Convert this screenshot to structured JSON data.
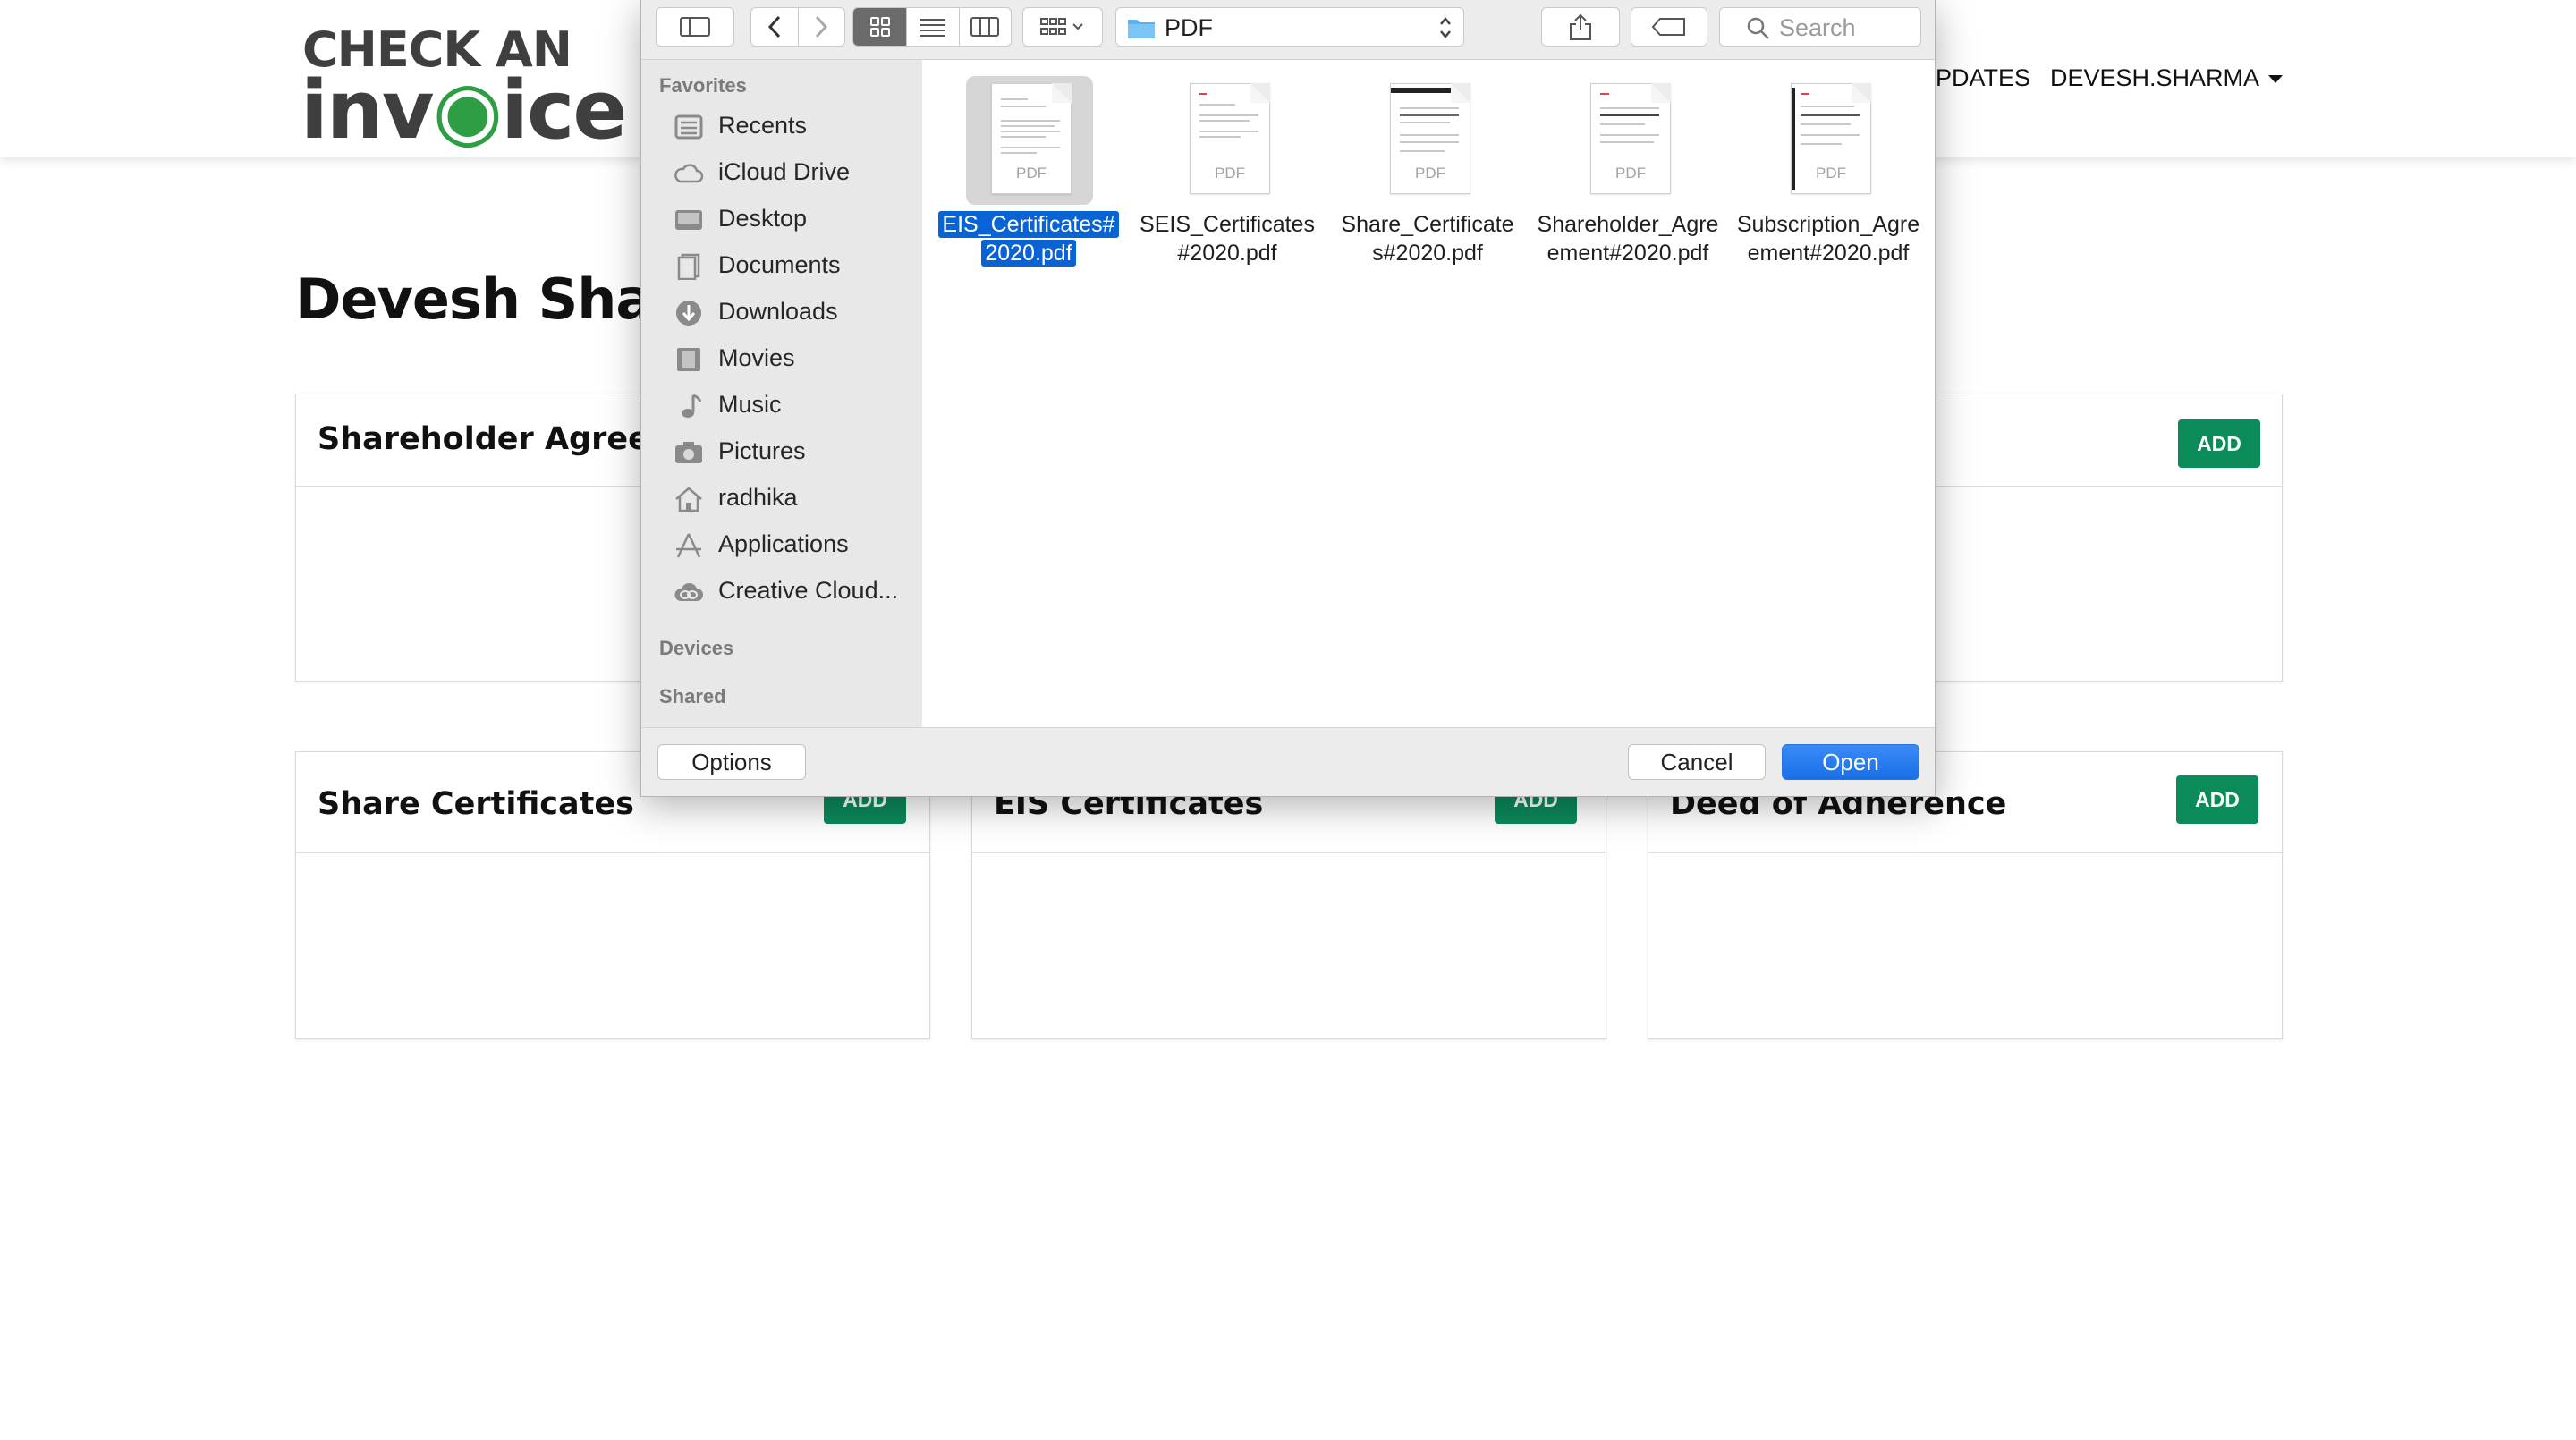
{
  "site": {
    "logo_line1": "CHECK AN",
    "logo_line2_a": "inv",
    "logo_line2_b": "ice",
    "logo_accent_color": "#2e9e44",
    "nav": {
      "updates_label": "PDATES",
      "user_label": "DEVESH.SHARMA"
    },
    "page_title": "Devesh Sharm",
    "cards": [
      {
        "title": "Shareholder Agreeme",
        "add_label": "ADD"
      },
      {
        "title": "Share Certificates",
        "add_label": "ADD"
      },
      {
        "title": "EIS Certificates",
        "add_label": "ADD"
      },
      {
        "title": "Deed of Adherence",
        "add_label": "ADD"
      }
    ],
    "add_button_color": "#0b8a5a"
  },
  "dialog": {
    "path_label": "PDF",
    "search_placeholder": "Search",
    "sidebar": {
      "favorites_label": "Favorites",
      "items": [
        {
          "label": "Recents",
          "icon": "recents-icon"
        },
        {
          "label": "iCloud Drive",
          "icon": "cloud-icon"
        },
        {
          "label": "Desktop",
          "icon": "desktop-icon"
        },
        {
          "label": "Documents",
          "icon": "documents-icon"
        },
        {
          "label": "Downloads",
          "icon": "downloads-icon"
        },
        {
          "label": "Movies",
          "icon": "movies-icon"
        },
        {
          "label": "Music",
          "icon": "music-icon"
        },
        {
          "label": "Pictures",
          "icon": "pictures-icon"
        },
        {
          "label": "radhika",
          "icon": "home-icon"
        },
        {
          "label": "Applications",
          "icon": "applications-icon"
        },
        {
          "label": "Creative Cloud...",
          "icon": "creative-cloud-icon"
        }
      ],
      "devices_label": "Devices",
      "shared_label": "Shared"
    },
    "files": [
      {
        "name_line1": "EIS_Certificates#",
        "name_line2": "2020.pdf",
        "type": "PDF",
        "selected": true
      },
      {
        "name_line1": "SEIS_Certificates",
        "name_line2": "#2020.pdf",
        "type": "PDF",
        "selected": false
      },
      {
        "name_line1": "Share_Certificate",
        "name_line2": "s#2020.pdf",
        "type": "PDF",
        "selected": false
      },
      {
        "name_line1": "Shareholder_Agre",
        "name_line2": "ement#2020.pdf",
        "type": "PDF",
        "selected": false
      },
      {
        "name_line1": "Subscription_Agre",
        "name_line2": "ement#2020.pdf",
        "type": "PDF",
        "selected": false
      }
    ],
    "options_label": "Options",
    "cancel_label": "Cancel",
    "open_label": "Open",
    "selection_color": "#0a63d4",
    "folder_color": "#5ab0f0"
  }
}
